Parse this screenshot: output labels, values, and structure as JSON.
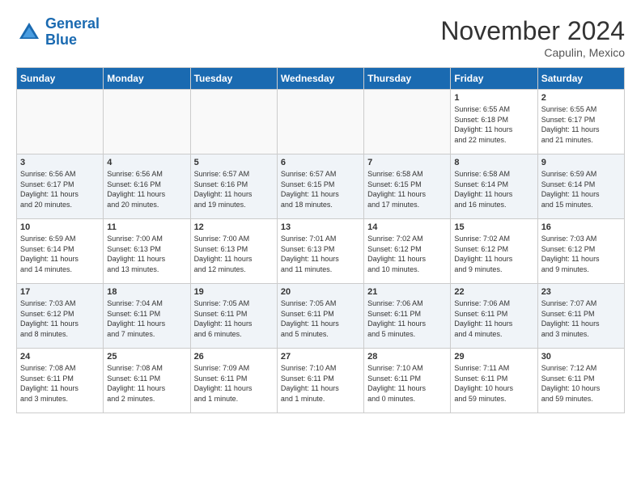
{
  "header": {
    "logo_line1": "General",
    "logo_line2": "Blue",
    "month": "November 2024",
    "location": "Capulin, Mexico"
  },
  "weekdays": [
    "Sunday",
    "Monday",
    "Tuesday",
    "Wednesday",
    "Thursday",
    "Friday",
    "Saturday"
  ],
  "weeks": [
    [
      {
        "day": "",
        "info": ""
      },
      {
        "day": "",
        "info": ""
      },
      {
        "day": "",
        "info": ""
      },
      {
        "day": "",
        "info": ""
      },
      {
        "day": "",
        "info": ""
      },
      {
        "day": "1",
        "info": "Sunrise: 6:55 AM\nSunset: 6:18 PM\nDaylight: 11 hours\nand 22 minutes."
      },
      {
        "day": "2",
        "info": "Sunrise: 6:55 AM\nSunset: 6:17 PM\nDaylight: 11 hours\nand 21 minutes."
      }
    ],
    [
      {
        "day": "3",
        "info": "Sunrise: 6:56 AM\nSunset: 6:17 PM\nDaylight: 11 hours\nand 20 minutes."
      },
      {
        "day": "4",
        "info": "Sunrise: 6:56 AM\nSunset: 6:16 PM\nDaylight: 11 hours\nand 20 minutes."
      },
      {
        "day": "5",
        "info": "Sunrise: 6:57 AM\nSunset: 6:16 PM\nDaylight: 11 hours\nand 19 minutes."
      },
      {
        "day": "6",
        "info": "Sunrise: 6:57 AM\nSunset: 6:15 PM\nDaylight: 11 hours\nand 18 minutes."
      },
      {
        "day": "7",
        "info": "Sunrise: 6:58 AM\nSunset: 6:15 PM\nDaylight: 11 hours\nand 17 minutes."
      },
      {
        "day": "8",
        "info": "Sunrise: 6:58 AM\nSunset: 6:14 PM\nDaylight: 11 hours\nand 16 minutes."
      },
      {
        "day": "9",
        "info": "Sunrise: 6:59 AM\nSunset: 6:14 PM\nDaylight: 11 hours\nand 15 minutes."
      }
    ],
    [
      {
        "day": "10",
        "info": "Sunrise: 6:59 AM\nSunset: 6:14 PM\nDaylight: 11 hours\nand 14 minutes."
      },
      {
        "day": "11",
        "info": "Sunrise: 7:00 AM\nSunset: 6:13 PM\nDaylight: 11 hours\nand 13 minutes."
      },
      {
        "day": "12",
        "info": "Sunrise: 7:00 AM\nSunset: 6:13 PM\nDaylight: 11 hours\nand 12 minutes."
      },
      {
        "day": "13",
        "info": "Sunrise: 7:01 AM\nSunset: 6:13 PM\nDaylight: 11 hours\nand 11 minutes."
      },
      {
        "day": "14",
        "info": "Sunrise: 7:02 AM\nSunset: 6:12 PM\nDaylight: 11 hours\nand 10 minutes."
      },
      {
        "day": "15",
        "info": "Sunrise: 7:02 AM\nSunset: 6:12 PM\nDaylight: 11 hours\nand 9 minutes."
      },
      {
        "day": "16",
        "info": "Sunrise: 7:03 AM\nSunset: 6:12 PM\nDaylight: 11 hours\nand 9 minutes."
      }
    ],
    [
      {
        "day": "17",
        "info": "Sunrise: 7:03 AM\nSunset: 6:12 PM\nDaylight: 11 hours\nand 8 minutes."
      },
      {
        "day": "18",
        "info": "Sunrise: 7:04 AM\nSunset: 6:11 PM\nDaylight: 11 hours\nand 7 minutes."
      },
      {
        "day": "19",
        "info": "Sunrise: 7:05 AM\nSunset: 6:11 PM\nDaylight: 11 hours\nand 6 minutes."
      },
      {
        "day": "20",
        "info": "Sunrise: 7:05 AM\nSunset: 6:11 PM\nDaylight: 11 hours\nand 5 minutes."
      },
      {
        "day": "21",
        "info": "Sunrise: 7:06 AM\nSunset: 6:11 PM\nDaylight: 11 hours\nand 5 minutes."
      },
      {
        "day": "22",
        "info": "Sunrise: 7:06 AM\nSunset: 6:11 PM\nDaylight: 11 hours\nand 4 minutes."
      },
      {
        "day": "23",
        "info": "Sunrise: 7:07 AM\nSunset: 6:11 PM\nDaylight: 11 hours\nand 3 minutes."
      }
    ],
    [
      {
        "day": "24",
        "info": "Sunrise: 7:08 AM\nSunset: 6:11 PM\nDaylight: 11 hours\nand 3 minutes."
      },
      {
        "day": "25",
        "info": "Sunrise: 7:08 AM\nSunset: 6:11 PM\nDaylight: 11 hours\nand 2 minutes."
      },
      {
        "day": "26",
        "info": "Sunrise: 7:09 AM\nSunset: 6:11 PM\nDaylight: 11 hours\nand 1 minute."
      },
      {
        "day": "27",
        "info": "Sunrise: 7:10 AM\nSunset: 6:11 PM\nDaylight: 11 hours\nand 1 minute."
      },
      {
        "day": "28",
        "info": "Sunrise: 7:10 AM\nSunset: 6:11 PM\nDaylight: 11 hours\nand 0 minutes."
      },
      {
        "day": "29",
        "info": "Sunrise: 7:11 AM\nSunset: 6:11 PM\nDaylight: 10 hours\nand 59 minutes."
      },
      {
        "day": "30",
        "info": "Sunrise: 7:12 AM\nSunset: 6:11 PM\nDaylight: 10 hours\nand 59 minutes."
      }
    ]
  ]
}
